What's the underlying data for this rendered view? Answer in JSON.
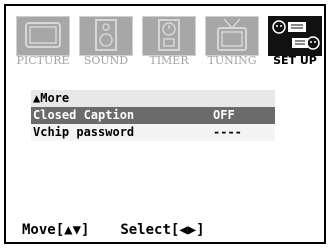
{
  "tabs": [
    {
      "label": "PICTURE",
      "icon": "tv-screen-icon"
    },
    {
      "label": "SOUND",
      "icon": "speaker-icon"
    },
    {
      "label": "TIMER",
      "icon": "timer-icon"
    },
    {
      "label": "TUNING",
      "icon": "antenna-tv-icon"
    },
    {
      "label": "SET UP",
      "icon": "setup-keyboard-icon"
    }
  ],
  "menu": {
    "header": "▲More",
    "items": [
      {
        "label": "Closed Caption",
        "value": "OFF"
      },
      {
        "label": "Vchip password",
        "value": "----"
      }
    ]
  },
  "footer": {
    "move": "Move[▲▼]",
    "select": "Select[◀▶]"
  },
  "colors": {
    "tab_inactive": "#a7a7a7",
    "tab_active": "#111111",
    "selected_row": "#6b6b6b"
  }
}
